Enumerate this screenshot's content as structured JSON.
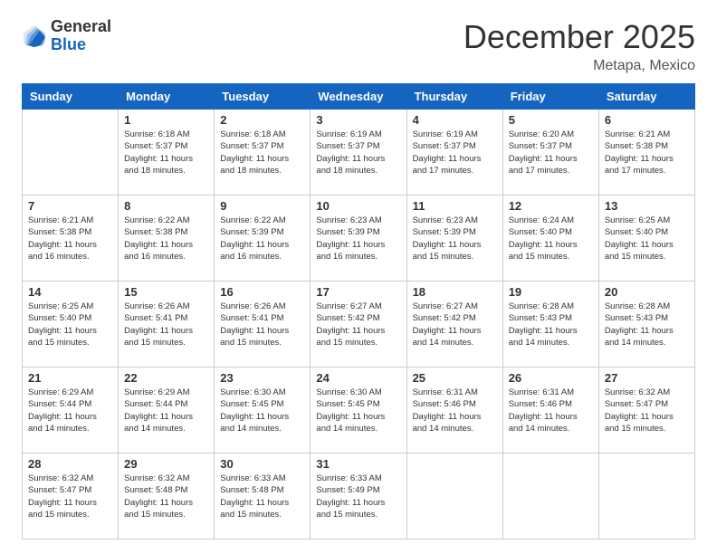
{
  "logo": {
    "general": "General",
    "blue": "Blue"
  },
  "header": {
    "month": "December 2025",
    "location": "Metapa, Mexico"
  },
  "weekdays": [
    "Sunday",
    "Monday",
    "Tuesday",
    "Wednesday",
    "Thursday",
    "Friday",
    "Saturday"
  ],
  "weeks": [
    [
      {
        "day": "",
        "info": ""
      },
      {
        "day": "1",
        "info": "Sunrise: 6:18 AM\nSunset: 5:37 PM\nDaylight: 11 hours\nand 18 minutes."
      },
      {
        "day": "2",
        "info": "Sunrise: 6:18 AM\nSunset: 5:37 PM\nDaylight: 11 hours\nand 18 minutes."
      },
      {
        "day": "3",
        "info": "Sunrise: 6:19 AM\nSunset: 5:37 PM\nDaylight: 11 hours\nand 18 minutes."
      },
      {
        "day": "4",
        "info": "Sunrise: 6:19 AM\nSunset: 5:37 PM\nDaylight: 11 hours\nand 17 minutes."
      },
      {
        "day": "5",
        "info": "Sunrise: 6:20 AM\nSunset: 5:37 PM\nDaylight: 11 hours\nand 17 minutes."
      },
      {
        "day": "6",
        "info": "Sunrise: 6:21 AM\nSunset: 5:38 PM\nDaylight: 11 hours\nand 17 minutes."
      }
    ],
    [
      {
        "day": "7",
        "info": "Sunrise: 6:21 AM\nSunset: 5:38 PM\nDaylight: 11 hours\nand 16 minutes."
      },
      {
        "day": "8",
        "info": "Sunrise: 6:22 AM\nSunset: 5:38 PM\nDaylight: 11 hours\nand 16 minutes."
      },
      {
        "day": "9",
        "info": "Sunrise: 6:22 AM\nSunset: 5:39 PM\nDaylight: 11 hours\nand 16 minutes."
      },
      {
        "day": "10",
        "info": "Sunrise: 6:23 AM\nSunset: 5:39 PM\nDaylight: 11 hours\nand 16 minutes."
      },
      {
        "day": "11",
        "info": "Sunrise: 6:23 AM\nSunset: 5:39 PM\nDaylight: 11 hours\nand 15 minutes."
      },
      {
        "day": "12",
        "info": "Sunrise: 6:24 AM\nSunset: 5:40 PM\nDaylight: 11 hours\nand 15 minutes."
      },
      {
        "day": "13",
        "info": "Sunrise: 6:25 AM\nSunset: 5:40 PM\nDaylight: 11 hours\nand 15 minutes."
      }
    ],
    [
      {
        "day": "14",
        "info": "Sunrise: 6:25 AM\nSunset: 5:40 PM\nDaylight: 11 hours\nand 15 minutes."
      },
      {
        "day": "15",
        "info": "Sunrise: 6:26 AM\nSunset: 5:41 PM\nDaylight: 11 hours\nand 15 minutes."
      },
      {
        "day": "16",
        "info": "Sunrise: 6:26 AM\nSunset: 5:41 PM\nDaylight: 11 hours\nand 15 minutes."
      },
      {
        "day": "17",
        "info": "Sunrise: 6:27 AM\nSunset: 5:42 PM\nDaylight: 11 hours\nand 15 minutes."
      },
      {
        "day": "18",
        "info": "Sunrise: 6:27 AM\nSunset: 5:42 PM\nDaylight: 11 hours\nand 14 minutes."
      },
      {
        "day": "19",
        "info": "Sunrise: 6:28 AM\nSunset: 5:43 PM\nDaylight: 11 hours\nand 14 minutes."
      },
      {
        "day": "20",
        "info": "Sunrise: 6:28 AM\nSunset: 5:43 PM\nDaylight: 11 hours\nand 14 minutes."
      }
    ],
    [
      {
        "day": "21",
        "info": "Sunrise: 6:29 AM\nSunset: 5:44 PM\nDaylight: 11 hours\nand 14 minutes."
      },
      {
        "day": "22",
        "info": "Sunrise: 6:29 AM\nSunset: 5:44 PM\nDaylight: 11 hours\nand 14 minutes."
      },
      {
        "day": "23",
        "info": "Sunrise: 6:30 AM\nSunset: 5:45 PM\nDaylight: 11 hours\nand 14 minutes."
      },
      {
        "day": "24",
        "info": "Sunrise: 6:30 AM\nSunset: 5:45 PM\nDaylight: 11 hours\nand 14 minutes."
      },
      {
        "day": "25",
        "info": "Sunrise: 6:31 AM\nSunset: 5:46 PM\nDaylight: 11 hours\nand 14 minutes."
      },
      {
        "day": "26",
        "info": "Sunrise: 6:31 AM\nSunset: 5:46 PM\nDaylight: 11 hours\nand 14 minutes."
      },
      {
        "day": "27",
        "info": "Sunrise: 6:32 AM\nSunset: 5:47 PM\nDaylight: 11 hours\nand 15 minutes."
      }
    ],
    [
      {
        "day": "28",
        "info": "Sunrise: 6:32 AM\nSunset: 5:47 PM\nDaylight: 11 hours\nand 15 minutes."
      },
      {
        "day": "29",
        "info": "Sunrise: 6:32 AM\nSunset: 5:48 PM\nDaylight: 11 hours\nand 15 minutes."
      },
      {
        "day": "30",
        "info": "Sunrise: 6:33 AM\nSunset: 5:48 PM\nDaylight: 11 hours\nand 15 minutes."
      },
      {
        "day": "31",
        "info": "Sunrise: 6:33 AM\nSunset: 5:49 PM\nDaylight: 11 hours\nand 15 minutes."
      },
      {
        "day": "",
        "info": ""
      },
      {
        "day": "",
        "info": ""
      },
      {
        "day": "",
        "info": ""
      }
    ]
  ]
}
